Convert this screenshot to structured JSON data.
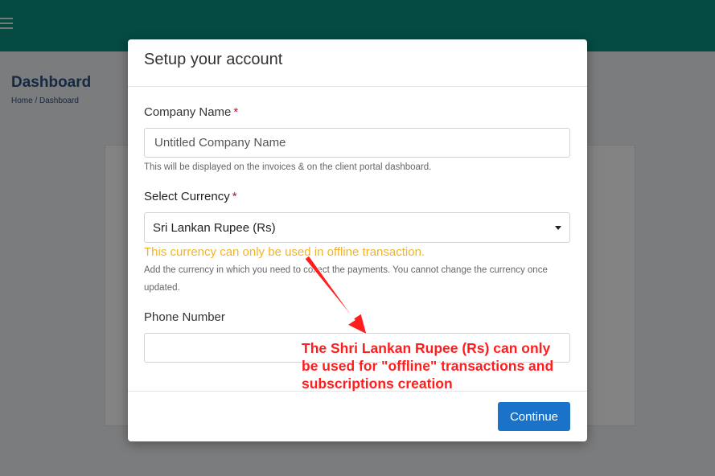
{
  "background": {
    "title": "Dashboard",
    "breadcrumb": "Home  /  Dashboard"
  },
  "modal": {
    "title": "Setup your account",
    "company": {
      "label": "Company Name",
      "required_mark": "*",
      "value": "Untitled Company Name",
      "help": "This will be displayed on the invoices & on the client portal dashboard."
    },
    "currency": {
      "label": "Select Currency",
      "required_mark": "*",
      "selected": "Sri Lankan Rupee (Rs)",
      "warning": "This currency can only be used in offline transaction.",
      "help": "Add the currency in which you need to collect the payments. You cannot change the currency once updated."
    },
    "phone": {
      "label": "Phone Number",
      "value": ""
    },
    "continue_label": "Continue"
  },
  "annotation": {
    "lines": [
      "The Shri Lankan Rupee (Rs) can only",
      "be used for \"offline\" transactions and",
      "subscriptions creation"
    ],
    "color": "#ff1d1d"
  },
  "colors": {
    "header": "#0a8f7e",
    "primary_button": "#1a73c8",
    "warning": "#f0b429",
    "required": "#b0162a"
  }
}
